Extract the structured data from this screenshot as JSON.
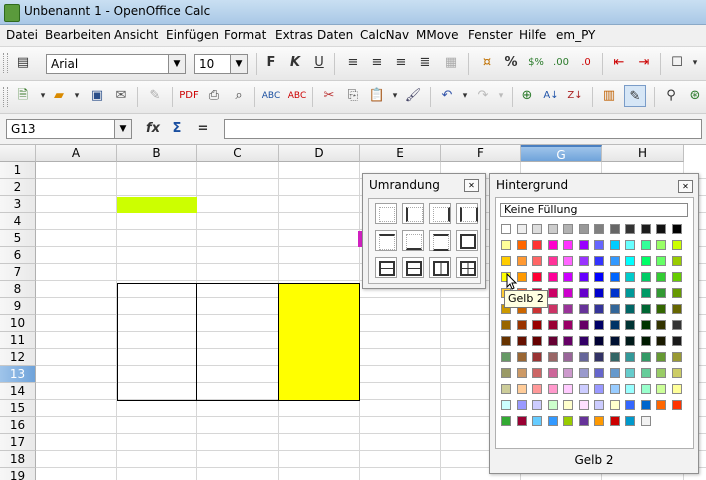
{
  "window": {
    "title": "Unbenannt 1 - OpenOffice Calc"
  },
  "menu": [
    "Datei",
    "Bearbeiten",
    "Ansicht",
    "Einfügen",
    "Format",
    "Extras",
    "Daten",
    "CalcNav",
    "MMove",
    "Fenster",
    "Hilfe",
    "em_PY"
  ],
  "formatting": {
    "font": "Arial",
    "size": "10"
  },
  "formula_bar": {
    "cell_ref": "G13",
    "content": ""
  },
  "columns": [
    "A",
    "B",
    "C",
    "D",
    "E",
    "F",
    "G",
    "H"
  ],
  "rows": [
    "1",
    "2",
    "3",
    "4",
    "5",
    "6",
    "7",
    "8",
    "9",
    "10",
    "11",
    "12",
    "13",
    "14",
    "15",
    "16",
    "17",
    "18",
    "19"
  ],
  "active_cell": {
    "column": "G",
    "row": "13"
  },
  "border_panel": {
    "title": "Umrandung"
  },
  "bg_panel": {
    "title": "Hintergrund",
    "none_label": "Keine Füllung",
    "tooltip": "Gelb 2",
    "status": "Gelb 2",
    "palette": [
      [
        "#ffffff",
        "#eeeeee",
        "#dddddd",
        "#cccccc",
        "#b2b2b2",
        "#999999",
        "#808080",
        "#666666",
        "#333333",
        "#1c1c1c",
        "#111111",
        "#000000"
      ],
      [
        "#ffff99",
        "#ff6600",
        "#ff3333",
        "#ff00cc",
        "#ff33ff",
        "#9900ff",
        "#6666ff",
        "#00ccff",
        "#66ffff",
        "#33ff99",
        "#99ff66",
        "#ccff00"
      ],
      [
        "#ffcc00",
        "#ff9933",
        "#ff6666",
        "#ff3399",
        "#ff66ff",
        "#9933ff",
        "#3333ff",
        "#3399ff",
        "#00ffff",
        "#00ff66",
        "#66ff66",
        "#99cc00"
      ],
      [
        "#ffff00",
        "#ff9900",
        "#ff0033",
        "#ff0099",
        "#cc00ff",
        "#6600ff",
        "#0000ff",
        "#0066ff",
        "#00cccc",
        "#00cc66",
        "#33cc33",
        "#66cc00"
      ],
      [
        "#ffcc33",
        "#ff6633",
        "#cc0033",
        "#cc0066",
        "#cc00cc",
        "#6600cc",
        "#0000cc",
        "#0033cc",
        "#009999",
        "#009966",
        "#339933",
        "#669900"
      ],
      [
        "#cc9900",
        "#cc6600",
        "#cc3333",
        "#cc3366",
        "#993399",
        "#663399",
        "#333399",
        "#336699",
        "#006666",
        "#006633",
        "#336600",
        "#666600"
      ],
      [
        "#996600",
        "#993300",
        "#990000",
        "#990033",
        "#990066",
        "#660066",
        "#000066",
        "#003366",
        "#003333",
        "#003300",
        "#333300",
        "#333333"
      ],
      [
        "#663300",
        "#661100",
        "#660000",
        "#660033",
        "#660066",
        "#330066",
        "#000033",
        "#001133",
        "#001a1a",
        "#001a00",
        "#1a1a00",
        "#1a1a1a"
      ],
      [
        "#669966",
        "#996633",
        "#993333",
        "#996666",
        "#996699",
        "#666699",
        "#333366",
        "#336666",
        "#339999",
        "#339966",
        "#669933",
        "#999933"
      ],
      [
        "#999966",
        "#cc9966",
        "#cc6666",
        "#cc6699",
        "#cc99cc",
        "#9999cc",
        "#6666cc",
        "#6699cc",
        "#66cccc",
        "#66cc99",
        "#99cc66",
        "#cccc66"
      ],
      [
        "#cccc99",
        "#ffcc99",
        "#ff9999",
        "#ff99cc",
        "#ffccff",
        "#ccccff",
        "#9999ff",
        "#99ccff",
        "#99ffff",
        "#99ffcc",
        "#ccff99",
        "#ffff99"
      ],
      [
        "#ccffff",
        "#9999ff",
        "#ccccff",
        "#ccffcc",
        "#ffffcc",
        "#ffe0ff",
        "#ccccff",
        "#ffffcc",
        "#3366ff",
        "#0066cc",
        "#ff6600",
        "#ff3300"
      ],
      [
        "#33aa33",
        "#990033",
        "#66ccff",
        "#3399ff",
        "#99cc00",
        "#663399",
        "#ff9900",
        "#cc0000",
        "#0099cc",
        "#f2f2f2"
      ]
    ]
  }
}
